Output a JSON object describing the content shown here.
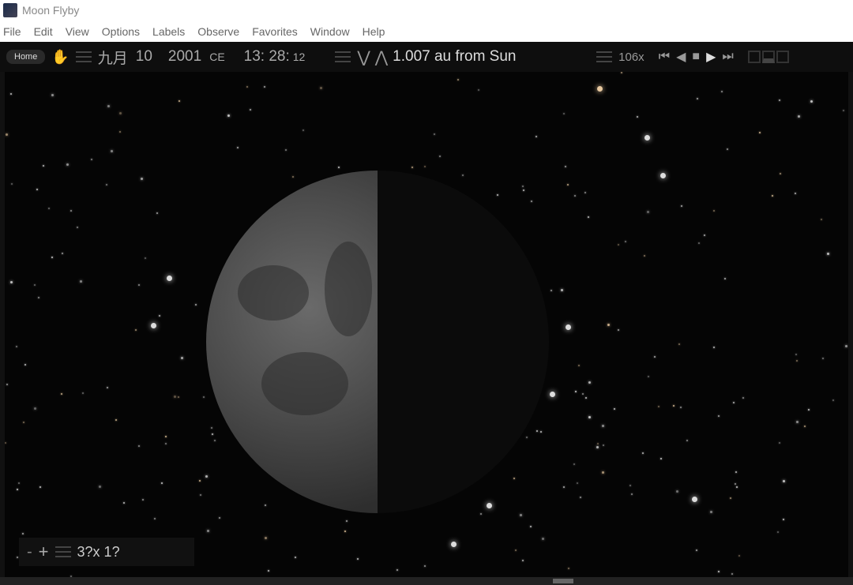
{
  "window": {
    "title": "Moon Flyby"
  },
  "menu": [
    "File",
    "Edit",
    "View",
    "Options",
    "Labels",
    "Observe",
    "Favorites",
    "Window",
    "Help"
  ],
  "toolbar": {
    "home": "Home",
    "month": "九月",
    "day": "10",
    "year": "2001",
    "era": "CE",
    "time_hm": "13: 28:",
    "time_s": "12",
    "distance": "1.007 au from Sun",
    "rate": "106x"
  },
  "zoom": {
    "fov": "3?x 1?"
  }
}
